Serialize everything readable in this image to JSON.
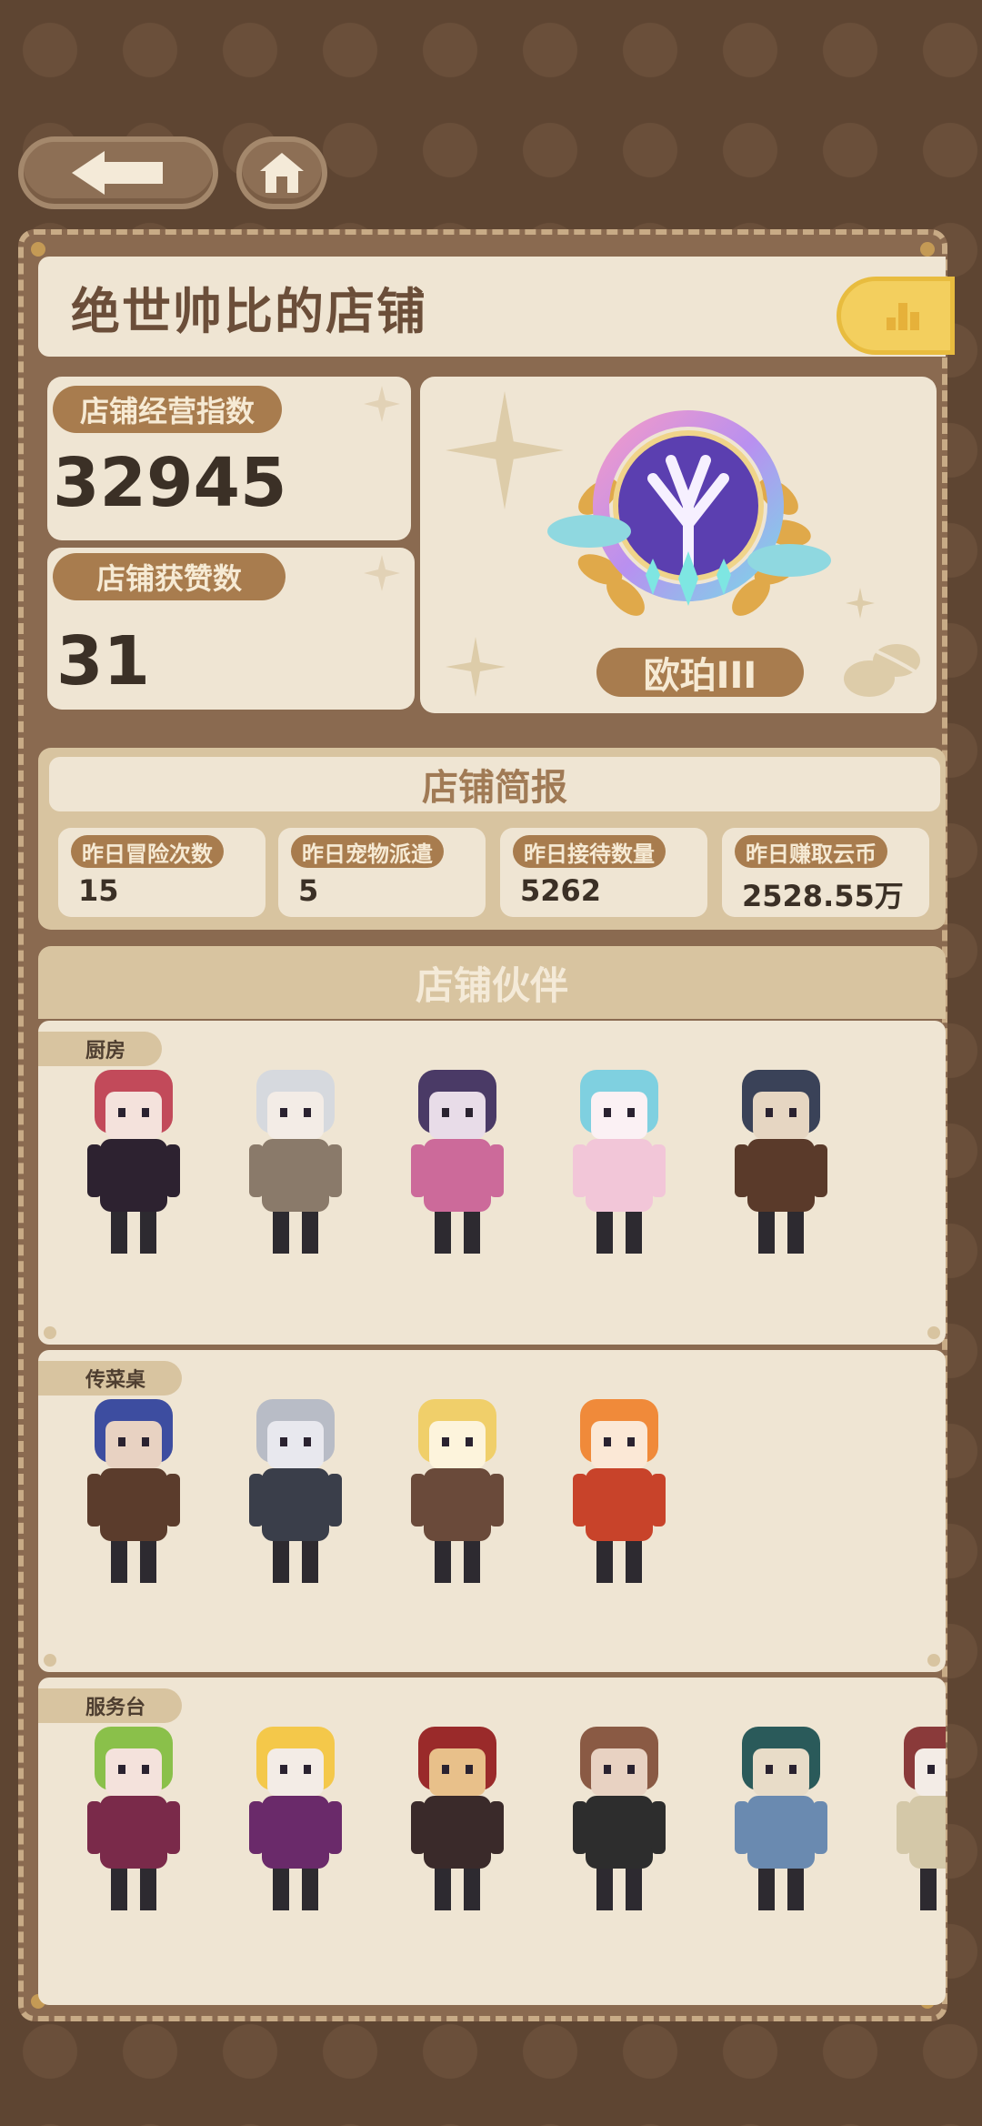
{
  "nav": {
    "back_icon": "arrow-left-icon",
    "home_icon": "home-icon"
  },
  "shop": {
    "name": "绝世帅比的店铺",
    "rank_icon": "bar-chart-icon"
  },
  "stats": {
    "index_label": "店铺经营指数",
    "index_value": "32945",
    "likes_label": "店铺获赞数",
    "likes_value": "31",
    "badge_label": "欧珀III"
  },
  "briefing": {
    "title": "店铺简报",
    "items": [
      {
        "label": "昨日冒险次数",
        "value": "15"
      },
      {
        "label": "昨日宠物派遣",
        "value": "5"
      },
      {
        "label": "昨日接待数量",
        "value": "5262"
      },
      {
        "label": "昨日赚取云币",
        "value": "2528.55万"
      }
    ]
  },
  "partners": {
    "title": "店铺伙伴",
    "sections": [
      {
        "name": "厨房",
        "count": 5
      },
      {
        "name": "传菜桌",
        "count": 4
      },
      {
        "name": "服务台",
        "count": 6
      }
    ]
  },
  "colors": {
    "panel": "#8a6a50",
    "card": "#efe5d3",
    "pill": "#a87c4e",
    "accent": "#f3cf5e"
  }
}
